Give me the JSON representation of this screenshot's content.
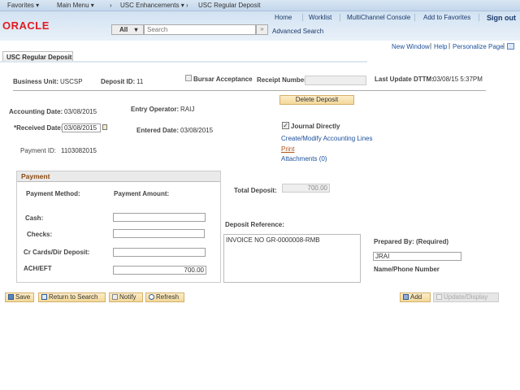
{
  "nav": {
    "favorites": "Favorites",
    "main_menu": "Main Menu",
    "enhancements": "USC Enhancements",
    "current": "USC Regular Deposit"
  },
  "header": {
    "logo": "ORACLE",
    "links": [
      "Home",
      "Worklist",
      "MultiChannel Console",
      "Add to Favorites",
      "Sign out"
    ],
    "search_scope": "All",
    "search_placeholder": "Search",
    "advanced_search": "Advanced Search"
  },
  "pagebar": {
    "links": [
      "New Window",
      "Help",
      "Personalize Page"
    ]
  },
  "tab": "USC Regular Deposit",
  "fields": {
    "business_unit_label": "Business Unit:",
    "business_unit": "USCSP",
    "deposit_id_label": "Deposit ID:",
    "deposit_id": "11",
    "bursar_label": "Bursar Acceptance",
    "bursar_checked": false,
    "receipt_label": "Receipt Number",
    "receipt_value": "",
    "last_update_label": "Last Update DTTM:",
    "last_update": "03/08/15  5:37PM",
    "delete_button": "Delete Deposit",
    "accounting_date_label": "Accounting Date:",
    "accounting_date": "03/08/2015",
    "entry_operator_label": "Entry Operator:",
    "entry_operator": "RAIJ",
    "received_date_label": "*Received Date:",
    "received_date": "03/08/2015",
    "entered_date_label": "Entered Date:",
    "entered_date": "03/08/2015",
    "journal_label": "Journal Directly",
    "journal_checked": true,
    "accounting_lines_link": "Create/Modify Accounting Lines",
    "print_link": "Print",
    "attachments_link": "Attachments (0)",
    "payment_id_label": "Payment ID:",
    "payment_id": "1103082015"
  },
  "payment": {
    "title": "Payment",
    "method_header": "Payment Method:",
    "amount_header": "Payment Amount:",
    "rows": [
      {
        "label": "Cash:",
        "value": ""
      },
      {
        "label": "Checks:",
        "value": ""
      },
      {
        "label": "Cr Cards/Dir Deposit:",
        "value": ""
      },
      {
        "label": "ACH/EFT",
        "value": "700.00"
      }
    ]
  },
  "total_label": "Total Deposit:",
  "total_value": "700.00",
  "deposit_ref_label": "Deposit Reference:",
  "deposit_ref": "INVOICE NO GR-0000008-RMB",
  "prepared_label": "Prepared By: (Required)",
  "prepared_value": "JRAI",
  "name_phone_label": "Name/Phone Number",
  "toolbar": {
    "save": "Save",
    "return": "Return to Search",
    "notify": "Notify",
    "refresh": "Refresh",
    "add": "Add",
    "update": "Update/Display"
  }
}
